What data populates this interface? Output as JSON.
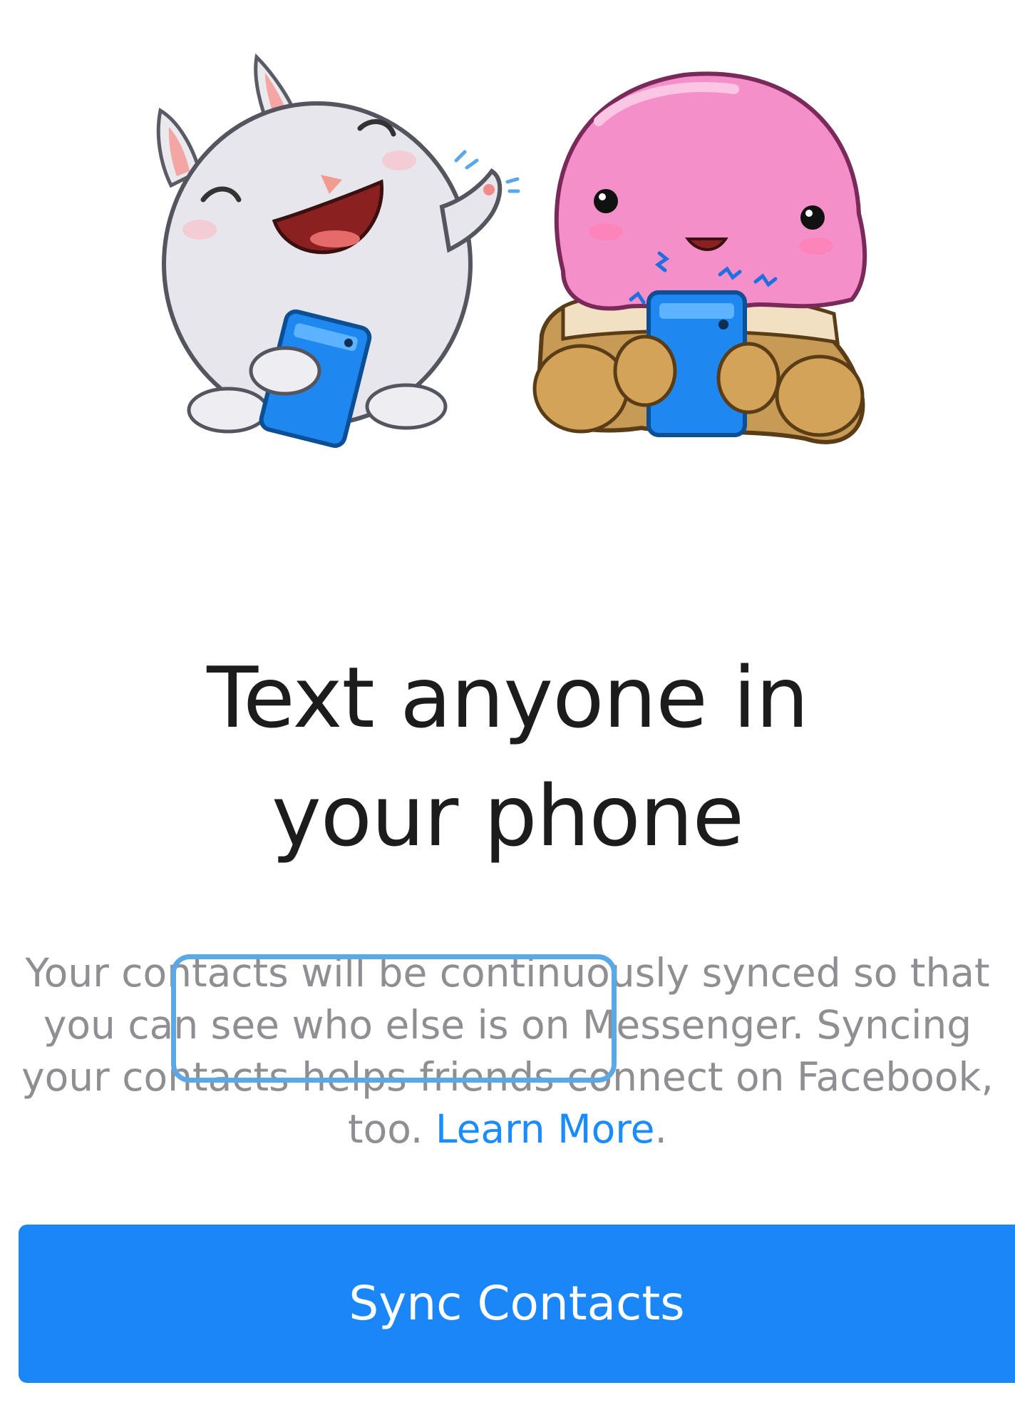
{
  "illustration": {
    "characters": [
      "bunny-sticker",
      "ice-cream-sticker"
    ],
    "phone_color": "#1e88f0"
  },
  "title": {
    "line1": "Text anyone in",
    "line2": "your phone"
  },
  "description": {
    "line1": "Your contacts will be continuously synced so that",
    "line2": "you can see who else is on Messenger. Syncing",
    "line3": "your contacts helps friends connect on Facebook,",
    "line4_prefix": "too. ",
    "learn_more": "Learn More",
    "line4_suffix": "."
  },
  "sync_button": {
    "label": "Sync Contacts"
  },
  "colors": {
    "accent": "#1a86f8",
    "link": "#1a8cff",
    "highlight": "#5aa9e6",
    "body_text": "#8e8e93",
    "title_text": "#1c1c1c"
  }
}
